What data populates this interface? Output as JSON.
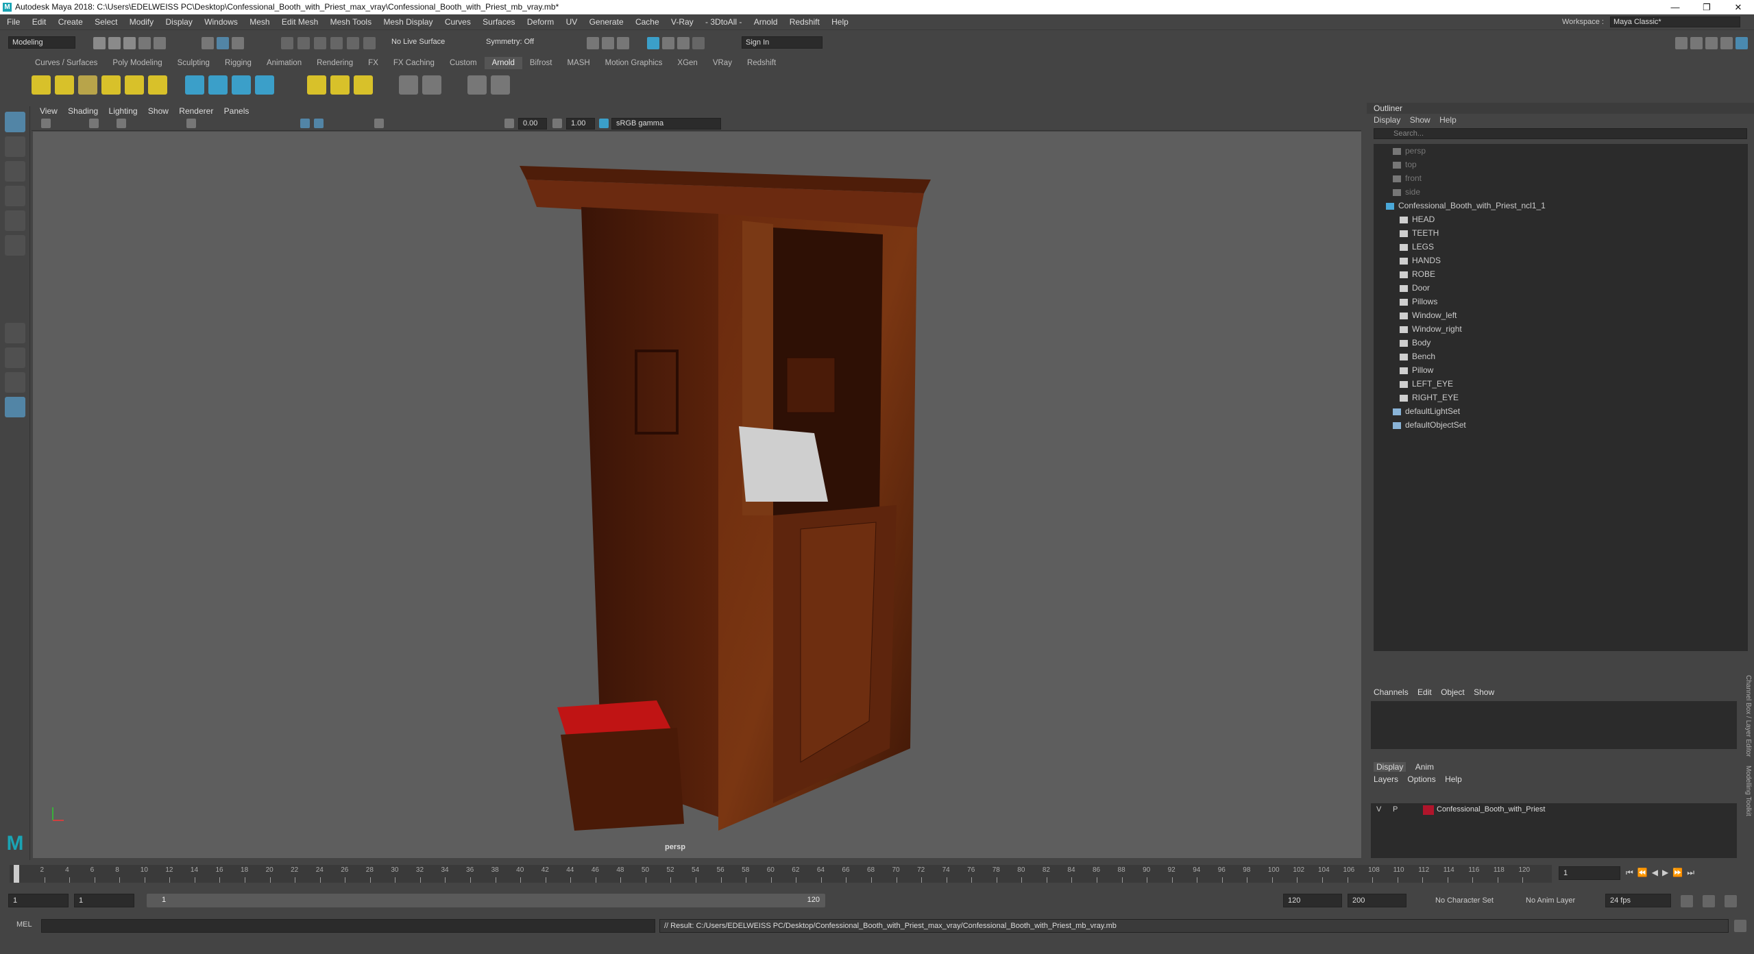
{
  "window": {
    "title": "Autodesk Maya 2018: C:\\Users\\EDELWEISS PC\\Desktop\\Confessional_Booth_with_Priest_max_vray\\Confessional_Booth_with_Priest_mb_vray.mb*",
    "controls": [
      "—",
      "❐",
      "✕"
    ]
  },
  "menubar": [
    "File",
    "Edit",
    "Create",
    "Select",
    "Modify",
    "Display",
    "Windows",
    "Mesh",
    "Edit Mesh",
    "Mesh Tools",
    "Mesh Display",
    "Curves",
    "Surfaces",
    "Deform",
    "UV",
    "Generate",
    "Cache",
    "V-Ray",
    "- 3DtoAll -",
    "Arnold",
    "Redshift",
    "Help"
  ],
  "workspace": {
    "label": "Workspace :",
    "value": "Maya Classic*"
  },
  "statusline": {
    "mode": "Modeling",
    "live_surface": "No Live Surface",
    "symmetry": "Symmetry: Off",
    "sign_in": "Sign In"
  },
  "shelf_tabs": [
    "Curves / Surfaces",
    "Poly Modeling",
    "Sculpting",
    "Rigging",
    "Animation",
    "Rendering",
    "FX",
    "FX Caching",
    "Custom",
    "Arnold",
    "Bifrost",
    "MASH",
    "Motion Graphics",
    "XGen",
    "VRay",
    "Redshift"
  ],
  "shelf_active": "Arnold",
  "panel_menu": [
    "View",
    "Shading",
    "Lighting",
    "Show",
    "Renderer",
    "Panels"
  ],
  "panel_tools": {
    "exposure": "0.00",
    "gamma": "1.00",
    "color_space": "sRGB gamma"
  },
  "viewport": {
    "camera_label": "persp"
  },
  "outliner": {
    "title": "Outliner",
    "menu": [
      "Display",
      "Show",
      "Help"
    ],
    "search_placeholder": "Search...",
    "items": [
      {
        "label": "persp",
        "kind": "camera",
        "dim": true,
        "indent": 1
      },
      {
        "label": "top",
        "kind": "camera",
        "dim": true,
        "indent": 1
      },
      {
        "label": "front",
        "kind": "camera",
        "dim": true,
        "indent": 1
      },
      {
        "label": "side",
        "kind": "camera",
        "dim": true,
        "indent": 1
      },
      {
        "label": "Confessional_Booth_with_Priest_ncl1_1",
        "kind": "group",
        "dim": false,
        "indent": 0
      },
      {
        "label": "HEAD",
        "kind": "mesh",
        "dim": false,
        "indent": 2
      },
      {
        "label": "TEETH",
        "kind": "mesh",
        "dim": false,
        "indent": 2
      },
      {
        "label": "LEGS",
        "kind": "mesh",
        "dim": false,
        "indent": 2
      },
      {
        "label": "HANDS",
        "kind": "mesh",
        "dim": false,
        "indent": 2
      },
      {
        "label": "ROBE",
        "kind": "mesh",
        "dim": false,
        "indent": 2
      },
      {
        "label": "Door",
        "kind": "mesh",
        "dim": false,
        "indent": 2
      },
      {
        "label": "Pillows",
        "kind": "mesh",
        "dim": false,
        "indent": 2
      },
      {
        "label": "Window_left",
        "kind": "mesh",
        "dim": false,
        "indent": 2
      },
      {
        "label": "Window_right",
        "kind": "mesh",
        "dim": false,
        "indent": 2
      },
      {
        "label": "Body",
        "kind": "mesh",
        "dim": false,
        "indent": 2
      },
      {
        "label": "Bench",
        "kind": "mesh",
        "dim": false,
        "indent": 2
      },
      {
        "label": "Pillow",
        "kind": "mesh",
        "dim": false,
        "indent": 2
      },
      {
        "label": "LEFT_EYE",
        "kind": "mesh",
        "dim": false,
        "indent": 2
      },
      {
        "label": "RIGHT_EYE",
        "kind": "mesh",
        "dim": false,
        "indent": 2
      },
      {
        "label": "defaultLightSet",
        "kind": "set",
        "dim": false,
        "indent": 1
      },
      {
        "label": "defaultObjectSet",
        "kind": "set",
        "dim": false,
        "indent": 1
      }
    ]
  },
  "channel_box": {
    "menu": [
      "Channels",
      "Edit",
      "Object",
      "Show"
    ]
  },
  "layer_editor": {
    "tabs": [
      "Display",
      "Anim"
    ],
    "menu": [
      "Layers",
      "Options",
      "Help"
    ],
    "layer": {
      "v": "V",
      "p": "P",
      "name": "Confessional_Booth_with_Priest",
      "color": "#b0152b"
    }
  },
  "side_tabs": [
    "Channel Box / Layer Editor",
    "Modelling Toolkit"
  ],
  "timeline": {
    "ticks": [
      "2",
      "4",
      "6",
      "8",
      "10",
      "12",
      "14",
      "16",
      "18",
      "20",
      "22",
      "24",
      "26",
      "28",
      "30",
      "32",
      "34",
      "36",
      "38",
      "40",
      "42",
      "44",
      "46",
      "48",
      "50",
      "52",
      "54",
      "56",
      "58",
      "60",
      "62",
      "64",
      "66",
      "68",
      "70",
      "72",
      "74",
      "76",
      "78",
      "80",
      "82",
      "84",
      "86",
      "88",
      "90",
      "92",
      "94",
      "96",
      "98",
      "100",
      "102",
      "104",
      "106",
      "108",
      "110",
      "112",
      "114",
      "116",
      "118",
      "120"
    ],
    "current": "1",
    "current_field": "1"
  },
  "range": {
    "start": "1",
    "start2": "1",
    "slider_start": "1",
    "slider_end": "120",
    "end": "120",
    "end2": "200",
    "character_set": "No Character Set",
    "anim_layer": "No Anim Layer",
    "fps": "24 fps"
  },
  "cmdline": {
    "lang": "MEL",
    "result": "// Result: C:/Users/EDELWEISS PC/Desktop/Confessional_Booth_with_Priest_max_vray/Confessional_Booth_with_Priest_mb_vray.mb"
  }
}
